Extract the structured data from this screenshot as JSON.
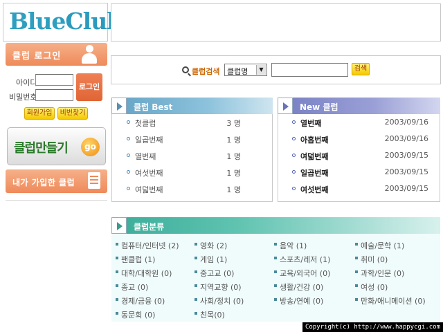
{
  "logo": {
    "blue": "Blue",
    "club": "Club"
  },
  "login": {
    "title": "클럽 로그인",
    "id_label": "아이디",
    "pw_label": "비밀번호",
    "login_button": "로그인",
    "join_button": "회원가입",
    "find_pw_button": "비번찾기"
  },
  "make_club": {
    "label": "클럽만들기",
    "go": "go"
  },
  "joined_clubs": {
    "label": "내가 가입한 클럽"
  },
  "search": {
    "label": "클럽검색",
    "select_value": "클럽명",
    "button": "검색"
  },
  "best": {
    "title": "클럽 Best",
    "rows": [
      {
        "name": "첫클럽",
        "count": "3 명"
      },
      {
        "name": "일곱번째",
        "count": "1 명"
      },
      {
        "name": "열번째",
        "count": "1 명"
      },
      {
        "name": "여섯번째",
        "count": "1 명"
      },
      {
        "name": "여덟번째",
        "count": "1 명"
      }
    ]
  },
  "new": {
    "title": "New 클럽",
    "rows": [
      {
        "name": "열번째",
        "date": "2003/09/16"
      },
      {
        "name": "아홉번째",
        "date": "2003/09/16"
      },
      {
        "name": "여덟번째",
        "date": "2003/09/15"
      },
      {
        "name": "일곱번째",
        "date": "2003/09/15"
      },
      {
        "name": "여섯번째",
        "date": "2003/09/15"
      }
    ]
  },
  "category": {
    "title": "클럽분류",
    "items": [
      "컴퓨터/인터넷 (2)",
      "영화 (2)",
      "음악 (1)",
      "예술/문학 (1)",
      "팬클럽 (1)",
      "게임 (1)",
      "스포츠/레저 (1)",
      "취미 (0)",
      "대학/대학원 (0)",
      "중고교 (0)",
      "교육/외국어 (0)",
      "과학/인문 (0)",
      "종교 (0)",
      "지역교향 (0)",
      "생활/건강 (0)",
      "여성 (0)",
      "경제/금융 (0)",
      "사회/정치 (0)",
      "방송/연예 (0)",
      "만화/애니메이션 (0)",
      "동문회 (0)",
      "친목(0)"
    ]
  },
  "footer": {
    "copyright": "Copyright(c) http://www.happycgi.com"
  }
}
